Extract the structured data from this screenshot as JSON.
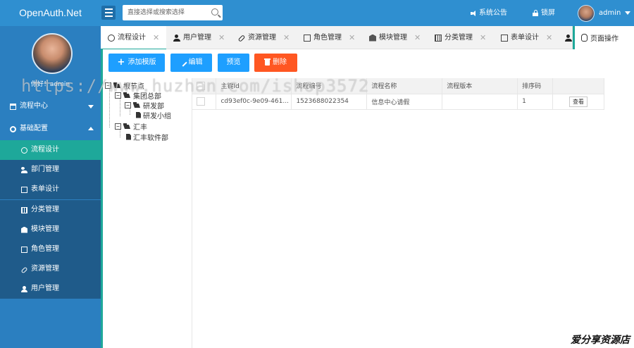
{
  "header": {
    "app_title": "OpenAuth.Net",
    "search_placeholder": "直接选择或搜索选择",
    "announcement_label": "系统公告",
    "lock_label": "锁屏",
    "username": "admin"
  },
  "sidebar": {
    "greeting": "你好！admin",
    "groups": [
      {
        "label": "流程中心",
        "expanded": false
      },
      {
        "label": "基础配置",
        "expanded": true
      }
    ],
    "items": [
      {
        "label": "流程设计",
        "icon": "flow-icon",
        "active": true
      },
      {
        "label": "部门管理",
        "icon": "users-icon",
        "active": false
      },
      {
        "label": "表单设计",
        "icon": "form-icon",
        "active": false
      },
      {
        "label": "分类管理",
        "icon": "category-icon",
        "active": false
      },
      {
        "label": "模块管理",
        "icon": "module-icon",
        "active": false
      },
      {
        "label": "角色管理",
        "icon": "checkbox-icon",
        "active": false
      },
      {
        "label": "资源管理",
        "icon": "link-icon",
        "active": false
      },
      {
        "label": "用户管理",
        "icon": "user-icon",
        "active": false
      }
    ]
  },
  "tabs": [
    {
      "label": "流程设计",
      "icon": "flow-icon",
      "active": true
    },
    {
      "label": "用户管理",
      "icon": "user-icon"
    },
    {
      "label": "资源管理",
      "icon": "link-icon"
    },
    {
      "label": "角色管理",
      "icon": "checkbox-icon"
    },
    {
      "label": "模块管理",
      "icon": "module-icon"
    },
    {
      "label": "分类管理",
      "icon": "category-icon"
    },
    {
      "label": "表单设计",
      "icon": "form-icon"
    }
  ],
  "page_actions_label": "页面操作",
  "toolbar": {
    "add_template": "添加模版",
    "edit": "编辑",
    "preview": "预览",
    "delete": "删除"
  },
  "tree": {
    "root": "根节点",
    "nodes": [
      {
        "label": "集团总部",
        "children": [
          {
            "label": "研发部",
            "children": [
              {
                "label": "研发小组"
              }
            ]
          }
        ]
      },
      {
        "label": "汇丰",
        "children": [
          {
            "label": "汇丰软件部"
          }
        ]
      }
    ]
  },
  "table": {
    "columns": [
      "主键Id",
      "流程编号",
      "流程名称",
      "流程版本",
      "排序码"
    ],
    "rows": [
      {
        "id": "cd93ef0c-9e09-461...",
        "code": "1523688022354",
        "name": "信息中心请假",
        "version": "",
        "sort": "1",
        "action": "查看"
      }
    ]
  },
  "watermarks": {
    "url": "https://www.huzhan.com/ishop3572",
    "shop": "爱分享资源店"
  },
  "colors": {
    "header_bg": "#2f8fd0",
    "sidebar_bg": "#2b7fc0",
    "submenu_bg": "#1f5b8a",
    "active_teal": "#1ea89a",
    "btn_blue": "#1e9fff",
    "btn_red": "#ff5722"
  }
}
